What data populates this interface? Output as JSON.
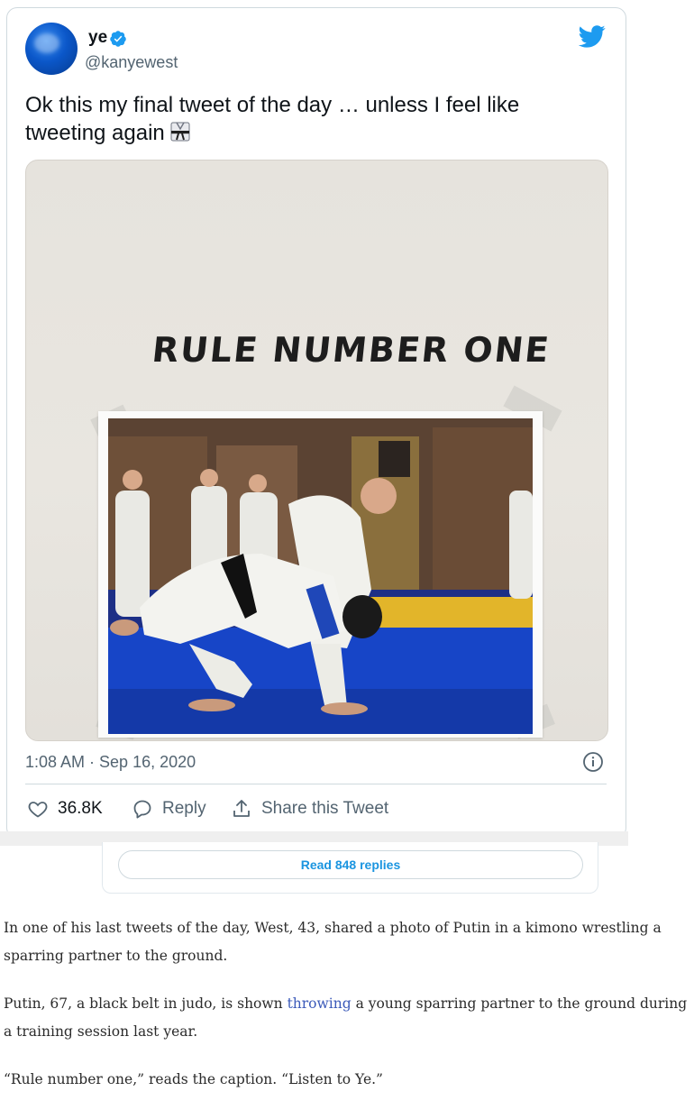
{
  "tweet": {
    "display_name": "ye",
    "handle": "@kanyewest",
    "text": "Ok this my final tweet of the day … unless I feel like tweeting again",
    "emoji_icon": "martial-arts-uniform-icon",
    "image_caption_handwritten": "RULE NUMBER ONE",
    "timestamp": "1:08 AM · Sep 16, 2020",
    "actions": {
      "likes_count": "36.8K",
      "reply_label": "Reply",
      "share_label": "Share this Tweet"
    },
    "read_replies_label": "Read 848 replies"
  },
  "colors": {
    "twitter_blue": "#1d9bf0",
    "link_blue": "#3b5ab9",
    "muted_gray": "#536471"
  },
  "article": {
    "p1": "In one of his last tweets of the day, West, 43, shared a photo of Putin in a kimono wrestling a sparring partner to the ground.",
    "p2_before": "Putin, 67, a black belt in judo, is shown ",
    "p2_link": "throwing",
    "p2_after": " a young sparring partner to the ground during a training session last year.",
    "p3": "“Rule number one,” reads the caption. “Listen to Ye.”"
  }
}
